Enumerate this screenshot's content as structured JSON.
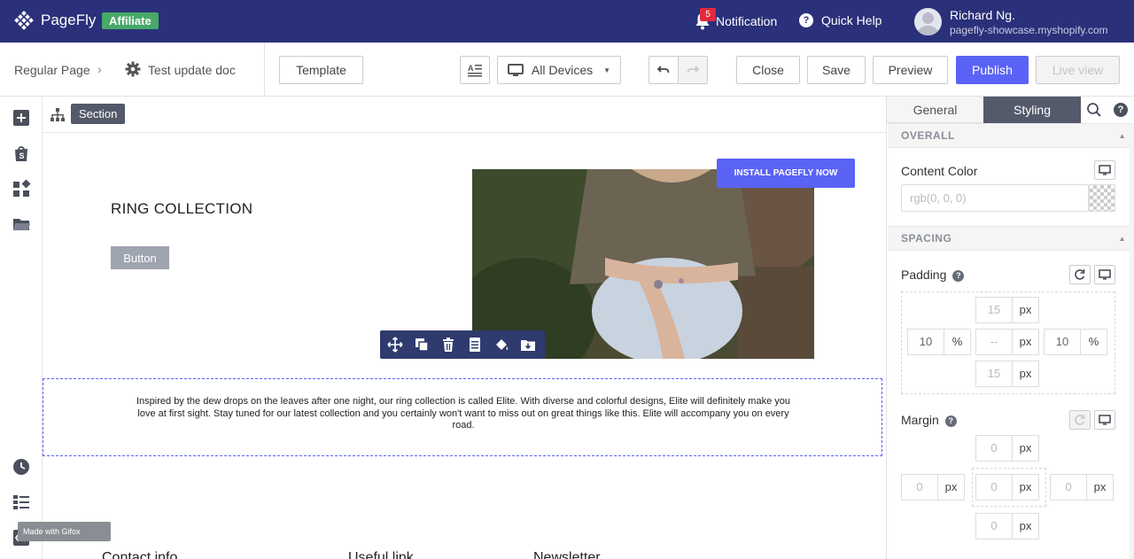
{
  "topnav": {
    "brand": "PageFly",
    "affiliate": "Affiliate",
    "notification_count": "5",
    "notification_label": "Notification",
    "help_label": "Quick Help",
    "user_name": "Richard Ng.",
    "user_shop": "pagefly-showcase.myshopify.com",
    "bg_color": "#2a3079"
  },
  "toolbar": {
    "breadcrumb_page": "Regular Page",
    "breadcrumb_sep": "›",
    "page_name": "Test update doc",
    "template": "Template",
    "devices": "All Devices",
    "close": "Close",
    "save": "Save",
    "preview": "Preview",
    "publish": "Publish",
    "live_view": "Live view"
  },
  "sidebar": {
    "items": [
      {
        "icon": "plus-square-icon"
      },
      {
        "icon": "shopify-bag-icon"
      },
      {
        "icon": "widgets-icon"
      },
      {
        "icon": "folder-icon"
      },
      {
        "icon": "history-clock-icon"
      },
      {
        "icon": "layers-list-icon"
      },
      {
        "icon": "code-icon"
      }
    ]
  },
  "canvas": {
    "section_tag": "Section",
    "heading": "RING COLLECTION",
    "button": "Button",
    "install_cta": "INSTALL PAGEFLY NOW",
    "paragraph": "Inspired by the dew drops on the leaves after one night, our ring collection is called Elite. With diverse and colorful designs, Elite will definitely make you love at first sight. Stay tuned for our latest collection and you certainly won't want to miss out on great things like this. Elite will accompany you on every road.",
    "footer_headings": [
      "Contact info",
      "Useful link",
      "Newsletter"
    ],
    "gifox": "Made with Gifox",
    "accent_color": "#5b63f6"
  },
  "panel": {
    "tabs": [
      "General",
      "Styling"
    ],
    "active_tab": "Styling",
    "overall": "OVERALL",
    "content_color_label": "Content Color",
    "content_color_value": "rgb(0, 0, 0)",
    "spacing": "SPACING",
    "padding_label": "Padding",
    "padding": {
      "top": {
        "value": "15",
        "unit": "px"
      },
      "left": {
        "value": "10",
        "unit": "%"
      },
      "center": {
        "value": "--",
        "unit": "px"
      },
      "right": {
        "value": "10",
        "unit": "%"
      },
      "bottom": {
        "value": "15",
        "unit": "px"
      }
    },
    "margin_label": "Margin",
    "margin": {
      "top": {
        "value": "0",
        "unit": "px"
      },
      "left": {
        "value": "0",
        "unit": "px"
      },
      "center": {
        "value": "0",
        "unit": "px"
      },
      "right": {
        "value": "0",
        "unit": "px"
      },
      "bottom": {
        "value": "0",
        "unit": "px"
      }
    }
  }
}
